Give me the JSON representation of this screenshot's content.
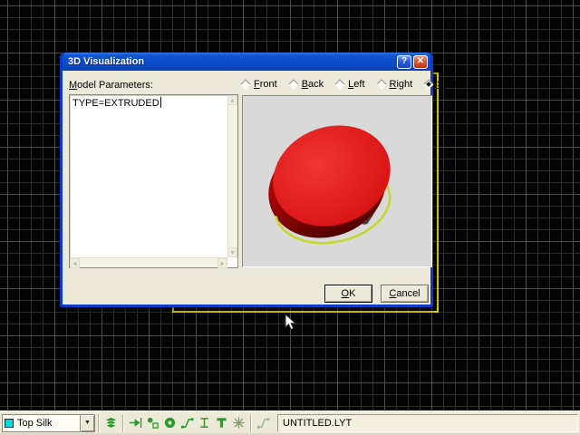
{
  "dialog": {
    "title": "3D Visualization",
    "help_glyph": "?",
    "close_glyph": "✕",
    "model_parameters_label": "Model Parameters:",
    "editor_text": "TYPE=EXTRUDED",
    "view_options": [
      {
        "label": "Front",
        "selected": false
      },
      {
        "label": "Back",
        "selected": false
      },
      {
        "label": "Left",
        "selected": false
      },
      {
        "label": "Right",
        "selected": false
      },
      {
        "label": "Spin",
        "selected": true
      }
    ],
    "buttons": {
      "ok": "OK",
      "cancel": "Cancel"
    }
  },
  "preview": {
    "description": "red extruded cylinder footprint with gray pin and yellow-green selection ring, spinning view",
    "colors": {
      "background": "#d9d9d9",
      "body_top": "#e11c1c",
      "body_side": "#8f0404",
      "pin": "#4a4a4a",
      "ring": "#c6d62e"
    }
  },
  "statusbar": {
    "layer_selector": {
      "value": "Top Silk",
      "swatch_color": "#00dcdc"
    },
    "tools": [
      {
        "icon": "layers-stack-icon"
      },
      {
        "icon": "component-place-icon"
      },
      {
        "icon": "pin-tool-icon"
      },
      {
        "icon": "via-tool-icon"
      },
      {
        "icon": "route-tool-icon"
      },
      {
        "icon": "dimension-tool-icon"
      },
      {
        "icon": "text-tool-icon"
      },
      {
        "icon": "error-marker-icon"
      },
      {
        "icon": "reconnect-tool-icon"
      }
    ],
    "filename": "UNTITLED.LYT"
  },
  "desktop": {
    "grid_minor_color": "#2e2e2e",
    "grid_major_color": "#4d4d4d",
    "selection_color": "#ece400"
  }
}
